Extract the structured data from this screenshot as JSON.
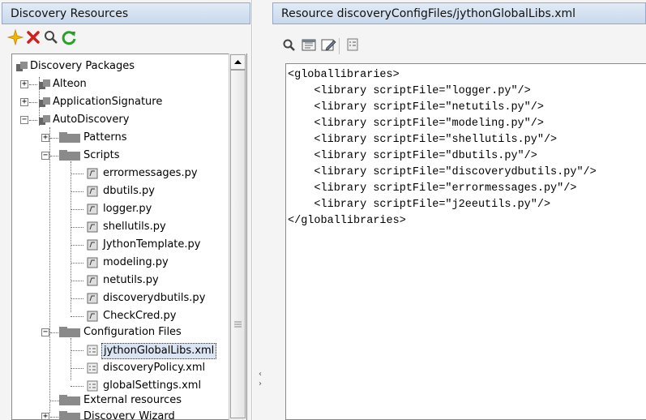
{
  "left_panel": {
    "title": "Discovery Resources",
    "toolbar": [
      {
        "icon": "new-star-icon",
        "color": "#f5b400"
      },
      {
        "icon": "delete-x-icon",
        "color": "#d0201a"
      },
      {
        "icon": "search-icon",
        "color": "#555555"
      },
      {
        "icon": "refresh-icon",
        "color": "#2aa02a"
      }
    ],
    "tree": {
      "root": "Discovery Packages",
      "packages": [
        "Alteon",
        "ApplicationSignature",
        "AutoDiscovery"
      ],
      "auto_children": {
        "patterns": "Patterns",
        "scripts": "Scripts",
        "script_files": [
          "errormessages.py",
          "dbutils.py",
          "logger.py",
          "shellutils.py",
          "JythonTemplate.py",
          "modeling.py",
          "netutils.py",
          "discoverydbutils.py",
          "CheckCred.py"
        ],
        "config": "Configuration Files",
        "config_files": [
          "jythonGlobalLibs.xml",
          "discoveryPolicy.xml",
          "globalSettings.xml"
        ],
        "external": "External resources",
        "wizard": "Discovery Wizard"
      }
    }
  },
  "right_panel": {
    "title": "Resource discoveryConfigFiles/jythonGlobalLibs.xml",
    "toolbar": [
      "search-icon",
      "view-icon",
      "edit-icon",
      "properties-icon"
    ],
    "code_lines": [
      "<globallibraries>",
      "    <library scriptFile=\"logger.py\"/>",
      "    <library scriptFile=\"netutils.py\"/>",
      "    <library scriptFile=\"modeling.py\"/>",
      "    <library scriptFile=\"shellutils.py\"/>",
      "    <library scriptFile=\"dbutils.py\"/>",
      "    <library scriptFile=\"discoverydbutils.py\"/>",
      "    <library scriptFile=\"errormessages.py\"/>",
      "    <library scriptFile=\"j2eeutils.py\"/>",
      "</globallibraries>"
    ]
  },
  "splitter": {
    "left_arrow": "‹",
    "right_arrow": "›"
  },
  "colors": {
    "header_gradient_top": "#e2ebf6",
    "header_gradient_bottom": "#c9d8ec",
    "folder": "#8a8a8a",
    "selection": "#dbe4f3"
  }
}
